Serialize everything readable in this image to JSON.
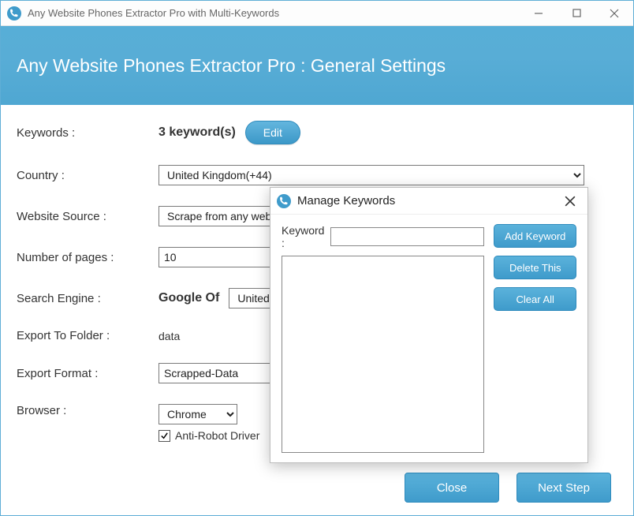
{
  "window": {
    "title": "Any Website Phones Extractor Pro with Multi-Keywords",
    "minimize": "—",
    "maximize": "▢",
    "close": "✕"
  },
  "header": {
    "title": "Any Website Phones Extractor Pro : General Settings"
  },
  "form": {
    "keywords_label": "Keywords :",
    "keywords_count": "3 keyword(s)",
    "edit_btn": "Edit",
    "country_label": "Country :",
    "country_value": "United Kingdom(+44)",
    "source_label": "Website Source :",
    "source_value": "Scrape from any website",
    "pages_label": "Number of pages :",
    "pages_value": "10",
    "engine_label": "Search Engine :",
    "engine_prefix": "Google Of",
    "engine_value": "United Kingdom",
    "export_folder_label": "Export To Folder :",
    "export_folder_value": "data",
    "export_format_label": "Export Format :",
    "export_format_value": "Scrapped-Data",
    "browser_label": "Browser :",
    "browser_value": "Chrome",
    "anti_robot_label": "Anti-Robot Driver",
    "anti_robot_checked": true
  },
  "footer": {
    "close": "Close",
    "next": "Next Step"
  },
  "dialog": {
    "title": "Manage Keywords",
    "keyword_label": "Keyword :",
    "keyword_value": "",
    "add_btn": "Add Keyword",
    "delete_btn": "Delete This",
    "clear_btn": "Clear All"
  }
}
